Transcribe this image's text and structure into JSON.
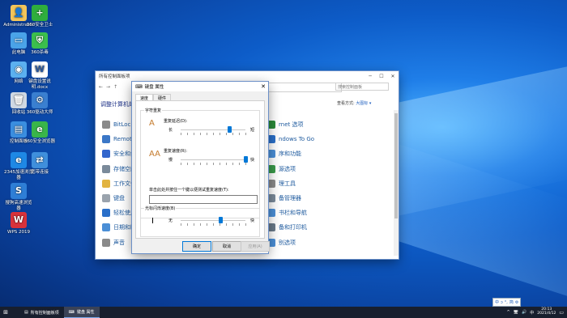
{
  "desktop_icons": [
    {
      "label": "Administrator",
      "icon": "user-folder-icon",
      "color": "#f2c55b",
      "glyph": "👤"
    },
    {
      "label": "360安全卫士",
      "icon": "360-guard-icon",
      "color": "#2fae3d",
      "glyph": "+"
    },
    {
      "label": "此电脑",
      "icon": "computer-icon",
      "color": "#4aa3e8",
      "glyph": "▭"
    },
    {
      "label": "360杀毒",
      "icon": "360-antivirus-icon",
      "color": "#3bbf4d",
      "glyph": "⛨"
    },
    {
      "label": "网络",
      "icon": "network-icon",
      "color": "#5bb0f0",
      "glyph": "◉"
    },
    {
      "label": "键盘设置说明.docx",
      "icon": "word-doc-icon",
      "color": "#ffffff",
      "glyph": "W"
    },
    {
      "label": "回收站",
      "icon": "recycle-bin-icon",
      "color": "#cfd8e3",
      "glyph": "🗑"
    },
    {
      "label": "360驱动大师",
      "icon": "360-driver-icon",
      "color": "#3a7fd0",
      "glyph": "⚙"
    },
    {
      "label": "控制面板",
      "icon": "control-panel-icon",
      "color": "#3a8ee0",
      "glyph": "▤"
    },
    {
      "label": "360安全浏览器",
      "icon": "360-browser-icon",
      "color": "#39b54a",
      "glyph": "e"
    },
    {
      "label": "2345加速浏览器",
      "icon": "2345-browser-icon",
      "color": "#1e88e5",
      "glyph": "e"
    },
    {
      "label": "宽带连接",
      "icon": "broadband-icon",
      "color": "#3f8fdc",
      "glyph": "⇄"
    },
    {
      "label": "搜狗高速浏览器",
      "icon": "sogou-browser-icon",
      "color": "#2e7ed6",
      "glyph": "S"
    },
    {
      "label": "WPS 2019",
      "icon": "wps-icon",
      "color": "#d8323b",
      "glyph": "W"
    }
  ],
  "control_panel": {
    "title": "所有控制面板项",
    "window_buttons": [
      "─",
      "☐",
      "✕"
    ],
    "nav": [
      "←",
      "→",
      "↑"
    ],
    "search_placeholder": "搜索控制面板",
    "heading": "调整计算机的设",
    "view_by_label": "查看方式:",
    "view_by_value": "大图标 ▾",
    "items_left": [
      {
        "label": "BitLock",
        "icon": "bitlocker-icon",
        "color": "#8a8a8a"
      },
      {
        "label": "Remote",
        "icon": "remote-icon",
        "color": "#3b77c7"
      },
      {
        "label": "安全和维",
        "icon": "security-icon",
        "color": "#3366cc"
      },
      {
        "label": "存储空间",
        "icon": "storage-icon",
        "color": "#7a8a9a"
      },
      {
        "label": "工作文件",
        "icon": "work-folders-icon",
        "color": "#e2b441"
      },
      {
        "label": "键盘",
        "icon": "keyboard-icon",
        "color": "#9aa3ad"
      },
      {
        "label": "轻松使用",
        "icon": "ease-of-access-icon",
        "color": "#2a6fc9"
      },
      {
        "label": "日期和时",
        "icon": "date-time-icon",
        "color": "#4b8fd6"
      },
      {
        "label": "声音",
        "icon": "sound-icon",
        "color": "#8a8a8a"
      }
    ],
    "items_right": [
      {
        "label": "rnet 选项",
        "icon": "internet-options-icon",
        "color": "#2a8a3a"
      },
      {
        "label": "ndows To Go",
        "icon": "windows-to-go-icon",
        "color": "#2a6fc9"
      },
      {
        "label": "序和功能",
        "icon": "programs-icon",
        "color": "#4b8fd6"
      },
      {
        "label": "源选项",
        "icon": "power-icon",
        "color": "#3a9a4a"
      },
      {
        "label": "理工具",
        "icon": "admin-tools-icon",
        "color": "#8a8a8a"
      },
      {
        "label": "备管理器",
        "icon": "device-manager-icon",
        "color": "#7a8a9a"
      },
      {
        "label": "书栏和导航",
        "icon": "taskbar-nav-icon",
        "color": "#4b8fd6"
      },
      {
        "label": "备和打印机",
        "icon": "printers-icon",
        "color": "#6a7a8a"
      },
      {
        "label": "别选项",
        "icon": "region-icon",
        "color": "#4b8fd6"
      }
    ]
  },
  "dialog": {
    "title": "键盘 属性",
    "close": "✕",
    "tabs": [
      "速度",
      "硬件"
    ],
    "char_repeat": {
      "group_label": "字符重复",
      "delay_label": "重复延迟(D):",
      "delay_min": "长",
      "delay_max": "短",
      "delay_value": 0.75,
      "rate_label": "重复速度(R):",
      "rate_min": "慢",
      "rate_max": "快",
      "rate_value": 1.0,
      "test_label": "单击此处并按住一个键以便测试重复速度(T):",
      "test_value": ""
    },
    "cursor_blink": {
      "group_label": "光标闪烁速度(B)",
      "min": "无",
      "max": "快",
      "value": 0.62
    },
    "buttons": {
      "ok": "确定",
      "cancel": "取消",
      "apply": "应用(A)"
    }
  },
  "taskbar": {
    "start_icon": "windows-start-icon",
    "apps": [
      {
        "label": "所有控制面板项",
        "icon": "control-panel-icon",
        "active": false
      },
      {
        "label": "键盘 属性",
        "icon": "keyboard-icon",
        "active": true
      }
    ],
    "tray": [
      "^",
      "🖥",
      "🔊",
      "中"
    ],
    "time": "20:13",
    "date": "2021/4/12"
  },
  "ime": {
    "items": [
      "中",
      "ɔ",
      "°,",
      "简",
      "⚙"
    ]
  }
}
